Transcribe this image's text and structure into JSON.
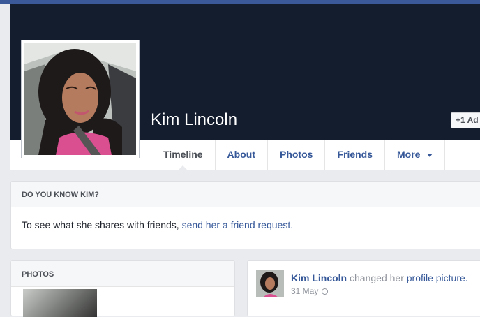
{
  "profile": {
    "name": "Kim Lincoln",
    "add_friend_label": "Ad",
    "add_friend_icon": "+1"
  },
  "tabs": [
    {
      "label": "Timeline",
      "active": true
    },
    {
      "label": "About"
    },
    {
      "label": "Photos"
    },
    {
      "label": "Friends"
    },
    {
      "label": "More"
    }
  ],
  "know_card": {
    "heading": "DO YOU KNOW KIM?",
    "text": "To see what she shares with friends, ",
    "link": "send her a friend request."
  },
  "photos_card": {
    "heading": "PHOTOS"
  },
  "post": {
    "actor": "Kim Lincoln",
    "verb": " changed her ",
    "object_link": "profile picture.",
    "date": "31 May"
  },
  "colors": {
    "brand": "#3b5998",
    "cover": "#141d2e",
    "link": "#365899"
  }
}
